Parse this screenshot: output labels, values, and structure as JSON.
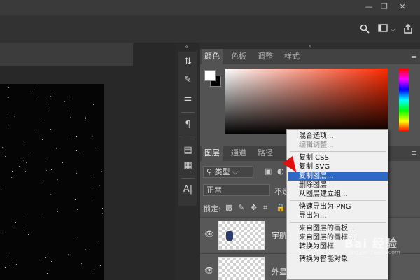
{
  "window": {
    "minimize": "—",
    "restore": "❐",
    "close": "✕"
  },
  "options_bar": {
    "icons": [
      "search-icon",
      "workspace-icon",
      "share-icon"
    ],
    "dropdown_caret": "⌵"
  },
  "color_panel": {
    "tabs": [
      {
        "label": "颜色",
        "active": true
      },
      {
        "label": "色板",
        "active": false
      },
      {
        "label": "调整",
        "active": false
      },
      {
        "label": "样式",
        "active": false
      }
    ],
    "menu": "≡",
    "foreground": "#ffffff",
    "background": "#000000",
    "hue_color": "#ff2a00"
  },
  "layers_panel": {
    "tabs": [
      {
        "label": "图层",
        "active": true
      },
      {
        "label": "通道",
        "active": false
      },
      {
        "label": "路径",
        "active": false
      }
    ],
    "menu": "≡",
    "filter_kind": "类型",
    "blend_mode": "正常",
    "opacity_label": "不透",
    "lock_label": "锁定:",
    "layers": [
      {
        "name": "宇航",
        "visible": true
      },
      {
        "name": "外星",
        "visible": true
      }
    ]
  },
  "context_menu": {
    "items": [
      {
        "label": "混合选项...",
        "state": "normal"
      },
      {
        "label": "编辑调整...",
        "state": "disabled"
      },
      {
        "label": "",
        "state": "separator"
      },
      {
        "label": "复制 CSS",
        "state": "normal"
      },
      {
        "label": "复制 SVG",
        "state": "normal"
      },
      {
        "label": "复制图层...",
        "state": "highlighted"
      },
      {
        "label": "删除图层",
        "state": "normal"
      },
      {
        "label": "从图层建立组...",
        "state": "normal"
      },
      {
        "label": "",
        "state": "separator"
      },
      {
        "label": "快速导出为 PNG",
        "state": "normal"
      },
      {
        "label": "导出为...",
        "state": "normal"
      },
      {
        "label": "",
        "state": "separator"
      },
      {
        "label": "来自图层的画板...",
        "state": "normal"
      },
      {
        "label": "来自图层的画框...",
        "state": "normal"
      },
      {
        "label": "转换为图框",
        "state": "normal"
      },
      {
        "label": "",
        "state": "separator"
      },
      {
        "label": "转换为智能对象",
        "state": "normal"
      }
    ]
  },
  "watermark": {
    "text": "Bai 经验",
    "sub": "jingyan.baidu.com"
  }
}
